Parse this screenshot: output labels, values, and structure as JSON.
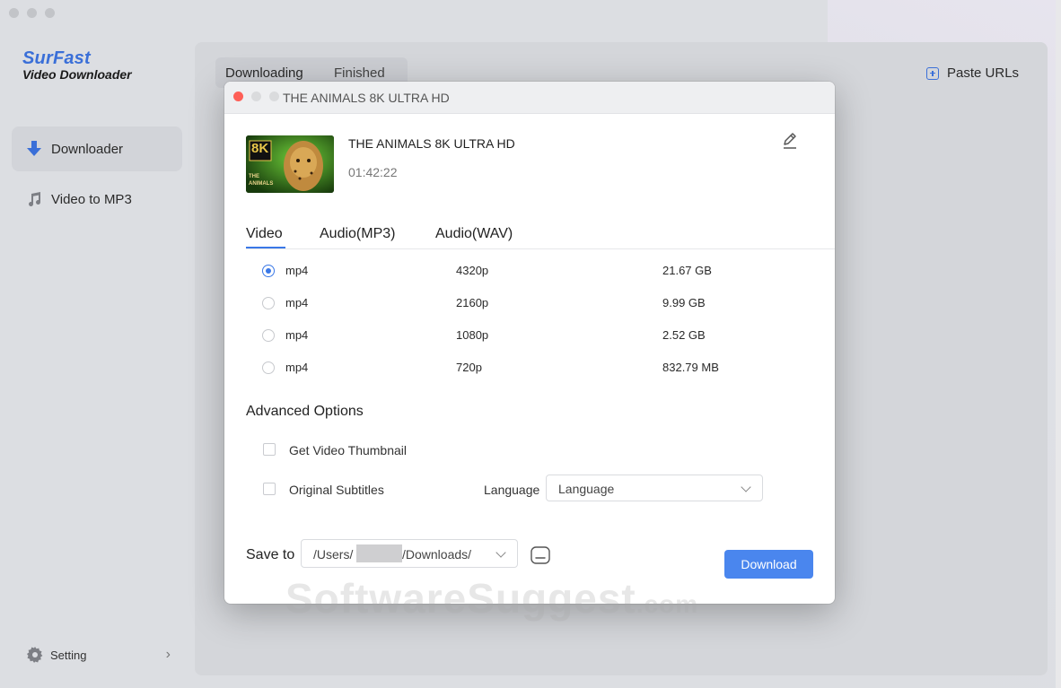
{
  "app": {
    "logo_line1": "SurFast",
    "logo_line2": "Video Downloader"
  },
  "sidebar": {
    "items": [
      {
        "label": "Downloader",
        "icon": "download-arrow-icon",
        "active": true
      },
      {
        "label": "Video to MP3",
        "icon": "music-note-icon",
        "active": false
      }
    ],
    "setting_label": "Setting"
  },
  "main": {
    "tabs": [
      {
        "label": "Downloading",
        "active": true
      },
      {
        "label": "Finished",
        "active": false
      }
    ],
    "paste_label": "Paste URLs"
  },
  "dialog": {
    "window_title": "THE ANIMALS 8K ULTRA HD",
    "video": {
      "title": "THE ANIMALS 8K ULTRA HD",
      "duration": "01:42:22",
      "thumb_badge": "8K",
      "thumb_caption": "THE ANIMALS"
    },
    "format_tabs": [
      {
        "label": "Video",
        "active": true
      },
      {
        "label": "Audio(MP3)",
        "active": false
      },
      {
        "label": "Audio(WAV)",
        "active": false
      }
    ],
    "formats": [
      {
        "type": "mp4",
        "resolution": "4320p",
        "size": "21.67 GB",
        "selected": true
      },
      {
        "type": "mp4",
        "resolution": "2160p",
        "size": "9.99 GB",
        "selected": false
      },
      {
        "type": "mp4",
        "resolution": "1080p",
        "size": "2.52 GB",
        "selected": false
      },
      {
        "type": "mp4",
        "resolution": "720p",
        "size": "832.79 MB",
        "selected": false
      }
    ],
    "advanced": {
      "title": "Advanced Options",
      "thumbnail_label": "Get Video Thumbnail",
      "subtitles_label": "Original Subtitles",
      "language_label": "Language",
      "language_value": "Language"
    },
    "save": {
      "label": "Save to",
      "path_prefix": "/Users/",
      "path_suffix": "/Downloads/"
    },
    "download_label": "Download"
  },
  "watermark": {
    "main": "SoftwareSuggest",
    "suffix": ".com"
  },
  "colors": {
    "accent": "#3a78e7",
    "button": "#4a86ee",
    "close_dot": "#fe5f57",
    "logo_blue": "#3a6fd8"
  }
}
